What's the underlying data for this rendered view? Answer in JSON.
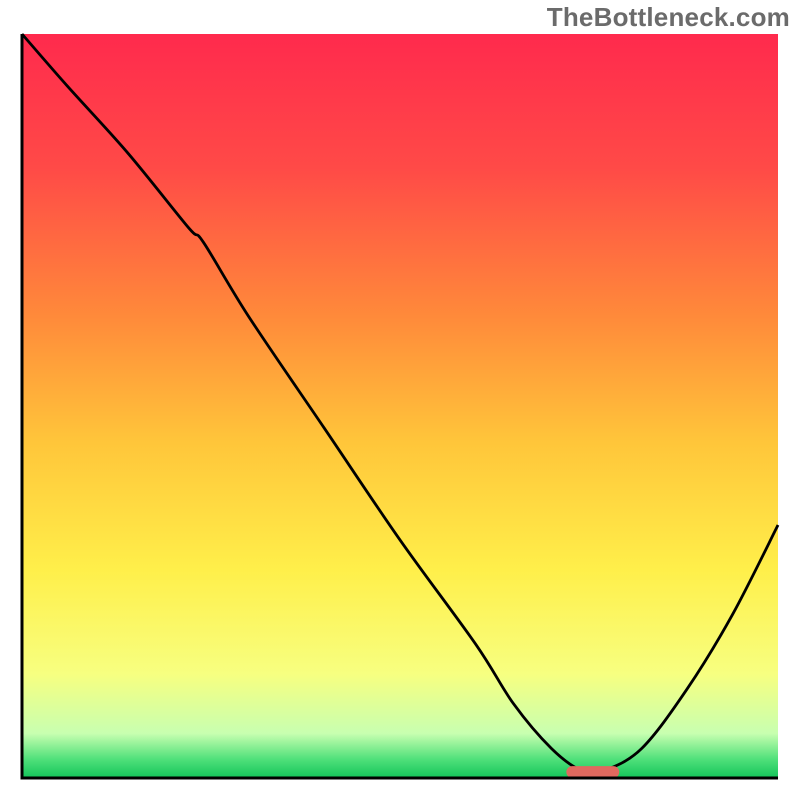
{
  "watermark": "TheBottleneck.com",
  "chart_data": {
    "type": "line",
    "title": "",
    "xlabel": "",
    "ylabel": "",
    "xlim": [
      0,
      100
    ],
    "ylim": [
      0,
      100
    ],
    "gradient_stops": [
      {
        "offset": 0.0,
        "color": "#ff2a4d"
      },
      {
        "offset": 0.18,
        "color": "#ff4a47"
      },
      {
        "offset": 0.38,
        "color": "#ff8a3a"
      },
      {
        "offset": 0.55,
        "color": "#ffc63a"
      },
      {
        "offset": 0.72,
        "color": "#ffef4a"
      },
      {
        "offset": 0.86,
        "color": "#f7ff80"
      },
      {
        "offset": 0.94,
        "color": "#c8ffb0"
      },
      {
        "offset": 0.975,
        "color": "#4fe07a"
      },
      {
        "offset": 1.0,
        "color": "#13c45a"
      }
    ],
    "series": [
      {
        "name": "bottleneck-curve",
        "x": [
          0,
          6,
          14,
          22,
          24,
          30,
          40,
          50,
          60,
          65,
          70,
          74,
          77,
          82,
          88,
          94,
          100
        ],
        "y": [
          100,
          93,
          84,
          74,
          72,
          62,
          47,
          32,
          18,
          10,
          4,
          1,
          1,
          4,
          12,
          22,
          34
        ]
      }
    ],
    "marker": {
      "name": "optimal-range-marker",
      "x_center": 75.5,
      "y": 0.8,
      "width": 7,
      "height": 1.6,
      "color": "#e0695f"
    },
    "axes": {
      "frame_color": "#000000",
      "frame_width": 3,
      "inner_background": "gradient"
    }
  }
}
